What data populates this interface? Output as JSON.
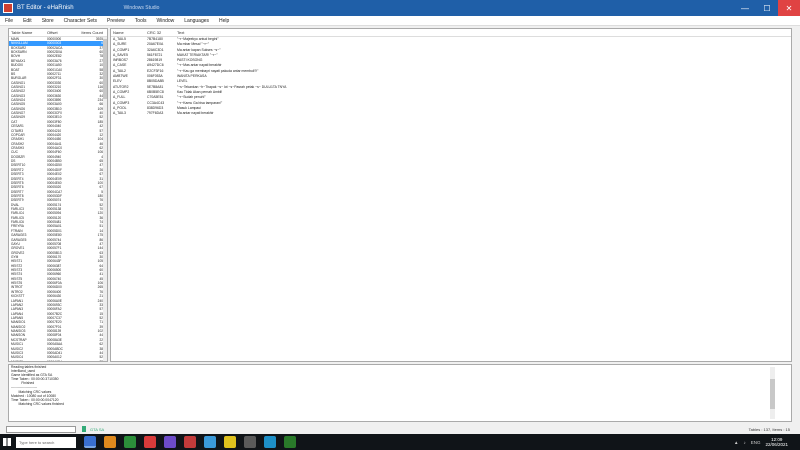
{
  "window": {
    "title": "BT Editor - eHaRnish",
    "subtitle": "Windows Studio",
    "controls": {
      "minimize": "—",
      "maximize": "☐",
      "close": "✕"
    }
  },
  "menu": [
    "File",
    "Edit",
    "Store",
    "Character Sets",
    "Preview",
    "Tools",
    "Window",
    "Languages",
    "Help"
  ],
  "tables": {
    "headers": {
      "name": "Table Name",
      "offset": "Offset",
      "count": "Items Count"
    },
    "selected_index": 1,
    "rows": [
      [
        "MAIN",
        "00000000",
        "3925"
      ],
      [
        "NIKKILLAM",
        "00000003",
        "6"
      ],
      [
        "BOXSAR2",
        "00002ACA",
        "37"
      ],
      [
        "BOXSARN",
        "00002D0A",
        "60"
      ],
      [
        "BOVH",
        "00002E82",
        "78"
      ],
      [
        "BEYAAX1",
        "00003A76",
        "27"
      ],
      [
        "BUDOI0",
        "00001A50",
        "10"
      ],
      [
        "BOAT",
        "00001CA0",
        "58"
      ],
      [
        "BS",
        "00002711",
        "32"
      ],
      [
        "BURGLAR",
        "00002F31",
        "30"
      ],
      [
        "CASINO1",
        "00003030",
        "60"
      ],
      [
        "CASINO1",
        "00003210",
        "116"
      ],
      [
        "CASINO2",
        "00003400",
        "60"
      ],
      [
        "CASINO3",
        "00003630",
        "44"
      ],
      [
        "CASINO4",
        "00003890",
        "234"
      ],
      [
        "CASINO5",
        "00003A00",
        "66"
      ],
      [
        "CASINO6",
        "00003B10",
        "109"
      ],
      [
        "CASINO7",
        "00003CF0",
        "40"
      ],
      [
        "CASINO9",
        "00003E10",
        "52"
      ],
      [
        "CAT",
        "00003F80",
        "185"
      ],
      [
        "CESAR1",
        "00004040",
        "42"
      ],
      [
        "CITAIR3",
        "00004210",
        "57"
      ],
      [
        "COPCAR",
        "00004420",
        "12"
      ],
      [
        "CRASH1",
        "00004450",
        "104"
      ],
      [
        "CRASH2",
        "00004A41",
        "46"
      ],
      [
        "CRASH3",
        "00004AC0",
        "62"
      ],
      [
        "CUC",
        "00004F60",
        "106"
      ],
      [
        "DOOBZR",
        "00004940",
        "4"
      ],
      [
        "DS",
        "00004B50",
        "65"
      ],
      [
        "DSERT10",
        "00004D50",
        "47"
      ],
      [
        "DSERT2",
        "00004D0F",
        "26"
      ],
      [
        "DSERT3",
        "00004E02",
        "67"
      ],
      [
        "DSERT4",
        "00004E09",
        "31"
      ],
      [
        "DSERT5",
        "00004E60",
        "100"
      ],
      [
        "DSERT6",
        "00005020",
        "67"
      ],
      [
        "DSERT7",
        "00004CA7",
        "5"
      ],
      [
        "DSERT8",
        "000053DF",
        "180"
      ],
      [
        "DSERT9",
        "00005074",
        "76"
      ],
      [
        "DVAL",
        "00005174",
        "52"
      ],
      [
        "FARLIC3",
        "00005138",
        "70"
      ],
      [
        "FARLIC4",
        "00005094",
        "120"
      ],
      [
        "FARLIC5",
        "00005120",
        "36"
      ],
      [
        "FARLIC6",
        "00005481",
        "74"
      ],
      [
        "FREYRA",
        "00005A01",
        "51"
      ],
      [
        "FTRAIN",
        "00005D01",
        "14"
      ],
      [
        "GARAGE3",
        "00005E80",
        "175"
      ],
      [
        "GARAGE5",
        "00005744",
        "86"
      ],
      [
        "GAYU",
        "00005708",
        "47"
      ],
      [
        "GROVE1",
        "000057F1",
        "144"
      ],
      [
        "GROVE2",
        "00005B13",
        "63"
      ],
      [
        "GYM",
        "00006170",
        "30"
      ],
      [
        "HEIST1",
        "0000643F",
        "105"
      ],
      [
        "HEIST2",
        "00006387",
        "64"
      ],
      [
        "HEIST3",
        "00006500",
        "60"
      ],
      [
        "HEIST4",
        "00006960",
        "41"
      ],
      [
        "HEIST5",
        "00006740",
        "45"
      ],
      [
        "HEIST6",
        "00006F0A",
        "106"
      ],
      [
        "INTROT",
        "00006D00",
        "265"
      ],
      [
        "INTRO2",
        "00006400",
        "76"
      ],
      [
        "KICKSTT",
        "00006430",
        "21"
      ],
      [
        "LAPAN1",
        "00006A0E",
        "240"
      ],
      [
        "LAPAN2",
        "0000693C",
        "33"
      ],
      [
        "LAPAN3",
        "00006FA2",
        "57"
      ],
      [
        "LAPAN4",
        "00007B2C",
        "15"
      ],
      [
        "LAPAN5",
        "00007C37",
        "52"
      ],
      [
        "MANSIO1",
        "00007E20",
        "71"
      ],
      [
        "MANSIO2",
        "00007F01",
        "39"
      ],
      [
        "MANSIO3",
        "00008139",
        "102"
      ],
      [
        "MANSON",
        "00008F04",
        "44"
      ],
      [
        "MCSTRAP",
        "00008A3E",
        "22"
      ],
      [
        "MUSIC1",
        "0000A5AA",
        "62"
      ],
      [
        "MUSIC2",
        "0000ABDC",
        "38"
      ],
      [
        "MUSIC3",
        "0000AD41",
        "44"
      ],
      [
        "MUSIC4",
        "0000A012",
        "52"
      ],
      [
        "MUSIC5",
        "0000A0E4",
        "73"
      ]
    ]
  },
  "strings": {
    "headers": {
      "name": "Name",
      "crc": "CRC 32",
      "text": "Text"
    },
    "rows": [
      [
        "A_TAIL5",
        "7B7B4180",
        "\"~r~Majeekyo antud begini\""
      ],
      [
        "A_SURE",
        "20A67E0A",
        "Ma mbar Mesa! \"~r~\""
      ],
      [
        "A_COMP1",
        "32A6C3D1",
        "Ma antar kapan Sukses  ~s~\""
      ],
      [
        "A_SAVE5",
        "561F8721",
        "MAKAT TERIAKTAR! \"~r~\""
      ],
      [
        "INRBOS7",
        "28619819",
        "PASTI KOSONG"
      ],
      [
        "A_CASE",
        "A9427DC6",
        "\"~r~Mas antar nayati berakhir"
      ],
      [
        "A_TAIL2",
        "E2CF3F16",
        "\"~r~Kau ga membayri nayati pakuda antar membuli?!\""
      ],
      [
        "AMBTWE",
        "006F053A",
        "WANITA PERKASA"
      ],
      [
        "ELEV",
        "8B05DA8B",
        "LEVEL"
      ],
      [
        "ATUTOR2",
        "5E7B8A81",
        "\"~s~Tekankan ~h~Thapak ~s~ lot ~s~Pasrah petak ~s~ DULU1TA TNYA"
      ],
      [
        "A_COMP2",
        "6B0B5EC8",
        "Kau Tidak Akan pernah Ambil!"
      ],
      [
        "A_FULL",
        "C70A5E51",
        "\"~r~Sudah penuh!\""
      ],
      [
        "A_COMP3",
        "CC3A4C43",
        "\"~r~Kamu Ga bisa tamparan!\""
      ],
      [
        "A_POOL",
        "838D96D3",
        "Masuk Lampaui"
      ],
      [
        "A_TAIL3",
        "797F6DA3",
        "Ma antar nayati berakhir"
      ]
    ]
  },
  "log": [
    "Reading tables finished",
    "InterBand_used",
    "Game identified as GTA SA",
    "Time Taken : 00:00:00.3710350",
    "           Finished",
    "",
    "-----------------------",
    "        Matching CRC values",
    "Matched : 10080 out of 10080",
    "Time Taken : 00:00:00.0047120",
    "        Matching CRC values finished"
  ],
  "status": {
    "search_placeholder": "",
    "status_text": "GTA SA",
    "counts": "Tables : 137, Items : 15"
  },
  "taskbar": {
    "search_placeholder": "Type here to search",
    "tray_lang": "ENG",
    "time": "12:09",
    "date": "22/06/2021",
    "apps": [
      "#3a6fd0",
      "#e08a1e",
      "#2c8f3a",
      "#d93b3b",
      "#6d4cc9",
      "#c23b3b",
      "#3b9ad9",
      "#e0c21e",
      "#5a5a5a",
      "#1e90c8",
      "#2a7a2a"
    ]
  }
}
